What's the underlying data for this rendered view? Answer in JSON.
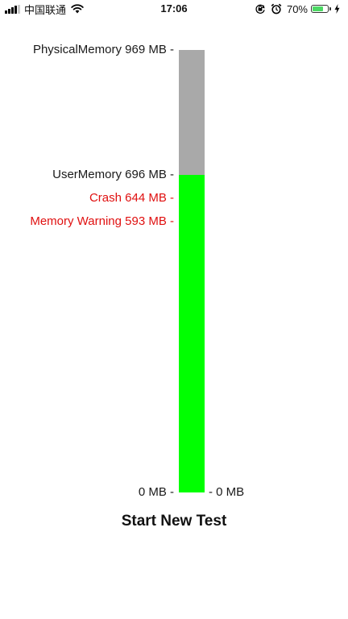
{
  "status_bar": {
    "carrier": "中国联通",
    "time": "17:06",
    "battery_percent": "70%",
    "battery_level": 0.7,
    "icons": [
      "signal-icon",
      "wifi-icon",
      "orientation-lock-icon",
      "alarm-icon",
      "battery-icon",
      "charging-bolt-icon"
    ]
  },
  "gauge": {
    "max_mb": 969,
    "used_mb": 696,
    "markers": [
      {
        "key": "physical",
        "label": "PhysicalMemory 969 MB -",
        "value_mb": 969,
        "warn": false
      },
      {
        "key": "user",
        "label": "UserMemory 696 MB -",
        "value_mb": 696,
        "warn": false
      },
      {
        "key": "crash",
        "label": "Crash 644 MB -",
        "value_mb": 644,
        "warn": true
      },
      {
        "key": "warning",
        "label": "Memory Warning 593 MB -",
        "value_mb": 593,
        "warn": true
      },
      {
        "key": "zero",
        "label": "0 MB -",
        "value_mb": 0,
        "warn": false
      }
    ],
    "right_label": "- 0 MB",
    "colors": {
      "used": "#00ff00",
      "free": "#a9a9a9",
      "warn_text": "#e01010"
    }
  },
  "actions": {
    "start_label": "Start New Test"
  }
}
